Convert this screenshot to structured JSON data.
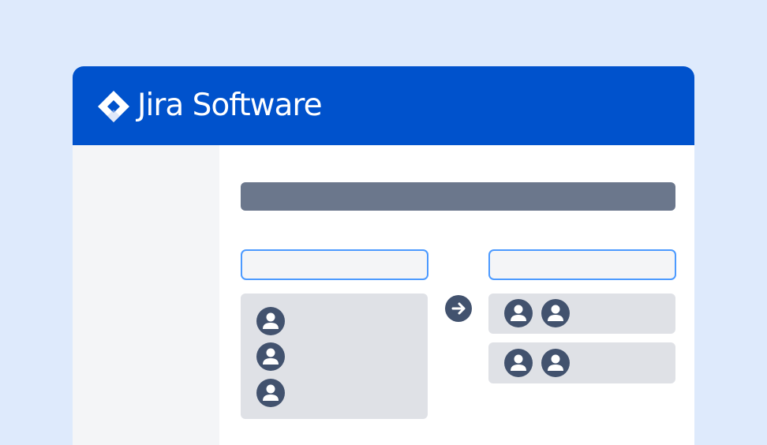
{
  "app": {
    "title": "Jira Software",
    "logo_icon": "jira-diamond-icon"
  },
  "colors": {
    "background": "#deeafc",
    "header": "#0052cc",
    "sidebar": "#f4f5f7",
    "title_bar": "#6b778c",
    "input_border": "#4c9aff",
    "panel": "#dfe1e6",
    "avatar": "#42526e"
  },
  "icons": {
    "avatar": "person-icon",
    "move": "arrow-right-circle-icon"
  },
  "source_group": {
    "member_count": 3
  },
  "target_groups": [
    {
      "member_count": 2
    },
    {
      "member_count": 2
    }
  ]
}
